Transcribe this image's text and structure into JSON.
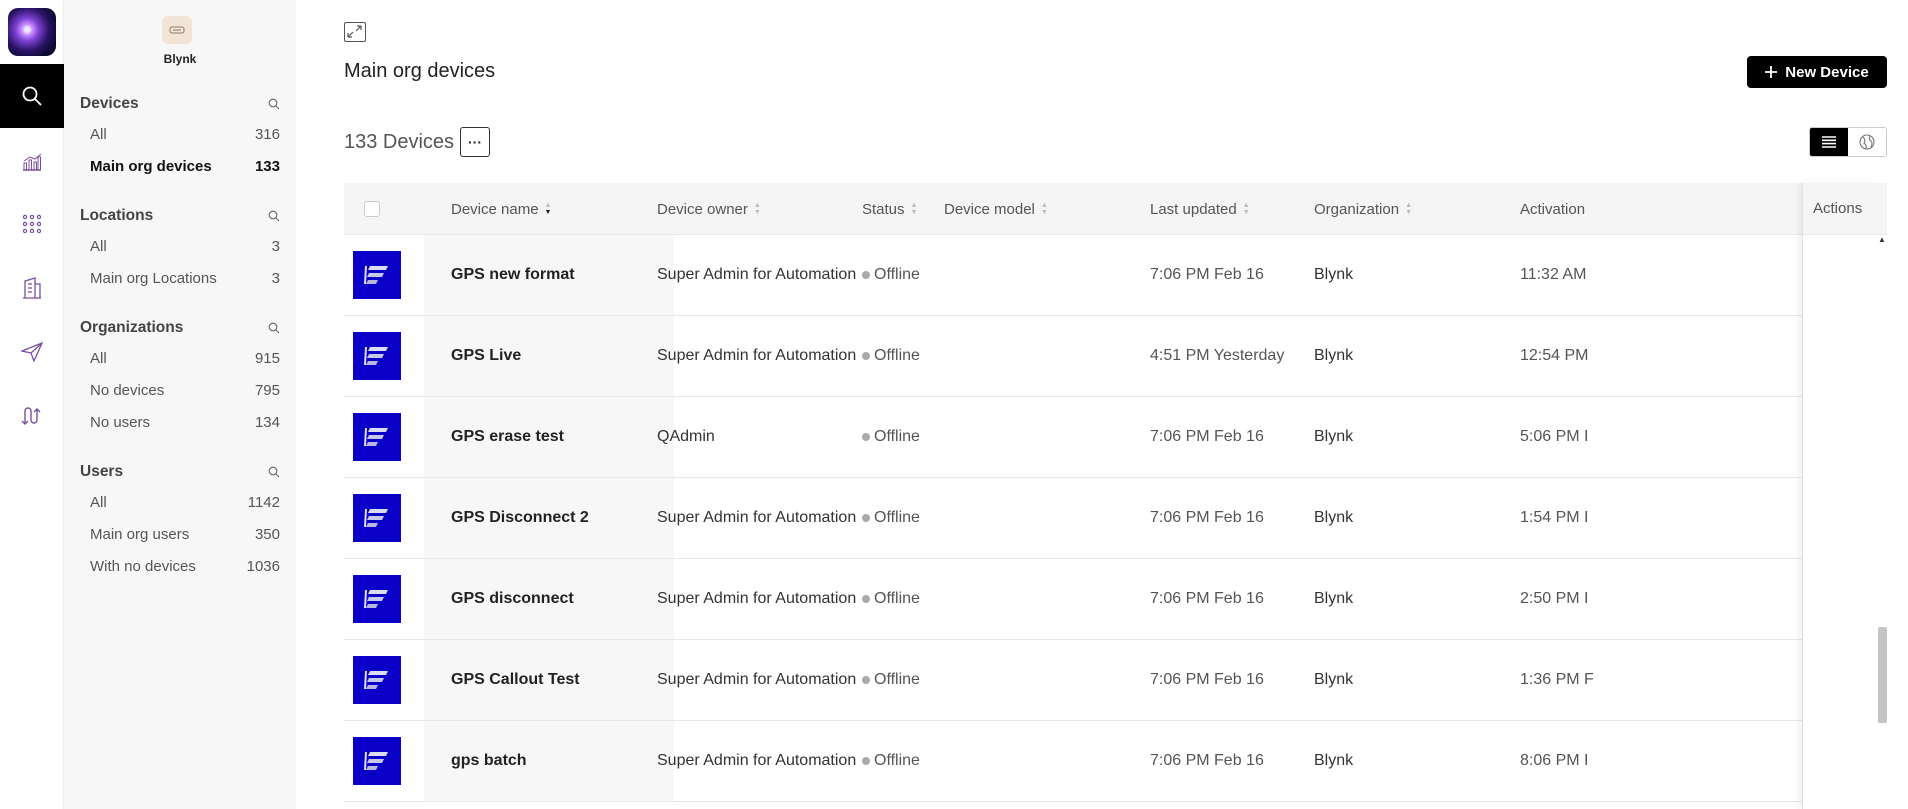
{
  "org": {
    "name": "Blynk"
  },
  "nav": {
    "sections": [
      {
        "title": "Devices",
        "items": [
          {
            "label": "All",
            "count": "316"
          },
          {
            "label": "Main org devices",
            "count": "133"
          }
        ]
      },
      {
        "title": "Locations",
        "items": [
          {
            "label": "All",
            "count": "3"
          },
          {
            "label": "Main org Locations",
            "count": "3"
          }
        ]
      },
      {
        "title": "Organizations",
        "items": [
          {
            "label": "All",
            "count": "915"
          },
          {
            "label": "No devices",
            "count": "795"
          },
          {
            "label": "No users",
            "count": "134"
          }
        ]
      },
      {
        "title": "Users",
        "items": [
          {
            "label": "All",
            "count": "1142"
          },
          {
            "label": "Main org users",
            "count": "350"
          },
          {
            "label": "With no devices",
            "count": "1036"
          }
        ]
      }
    ],
    "selected": "Main org devices"
  },
  "rail": {
    "icons": [
      "search-icon",
      "analytics-icon",
      "apps-grid-icon",
      "building-icon",
      "send-icon",
      "flow-icon"
    ]
  },
  "header": {
    "title": "Main org devices",
    "new_button": "New Device",
    "count_label": "133 Devices",
    "more_label": "···"
  },
  "table": {
    "columns": {
      "name": "Device name",
      "owner": "Device owner",
      "status": "Status",
      "model": "Device model",
      "updated": "Last updated",
      "org": "Organization",
      "activation": "Activation",
      "actions": "Actions"
    },
    "rows": [
      {
        "name": "GPS new format",
        "owner": "Super Admin for Automation",
        "status": "Offline",
        "model": "",
        "updated": "7:06 PM Feb 16",
        "org": "Blynk",
        "activation": "11:32 AM"
      },
      {
        "name": "GPS Live",
        "owner": "Super Admin for Automation",
        "status": "Offline",
        "model": "",
        "updated": "4:51 PM Yesterday",
        "org": "Blynk",
        "activation": "12:54 PM"
      },
      {
        "name": "GPS erase test",
        "owner": "QAdmin",
        "status": "Offline",
        "model": "",
        "updated": "7:06 PM Feb 16",
        "org": "Blynk",
        "activation": "5:06 PM I"
      },
      {
        "name": "GPS Disconnect 2",
        "owner": "Super Admin for Automation",
        "status": "Offline",
        "model": "",
        "updated": "7:06 PM Feb 16",
        "org": "Blynk",
        "activation": "1:54 PM I"
      },
      {
        "name": "GPS disconnect",
        "owner": "Super Admin for Automation",
        "status": "Offline",
        "model": "",
        "updated": "7:06 PM Feb 16",
        "org": "Blynk",
        "activation": "2:50 PM I"
      },
      {
        "name": "GPS Callout Test",
        "owner": "Super Admin for Automation",
        "status": "Offline",
        "model": "",
        "updated": "7:06 PM Feb 16",
        "org": "Blynk",
        "activation": "1:36 PM F"
      },
      {
        "name": "gps batch",
        "owner": "Super Admin for Automation",
        "status": "Offline",
        "model": "",
        "updated": "7:06 PM Feb 16",
        "org": "Blynk",
        "activation": "8:06 PM I"
      }
    ]
  },
  "colors": {
    "accent": "#000000",
    "device_tile": "#0a00c8",
    "panel_bg": "#f7f7f7"
  }
}
